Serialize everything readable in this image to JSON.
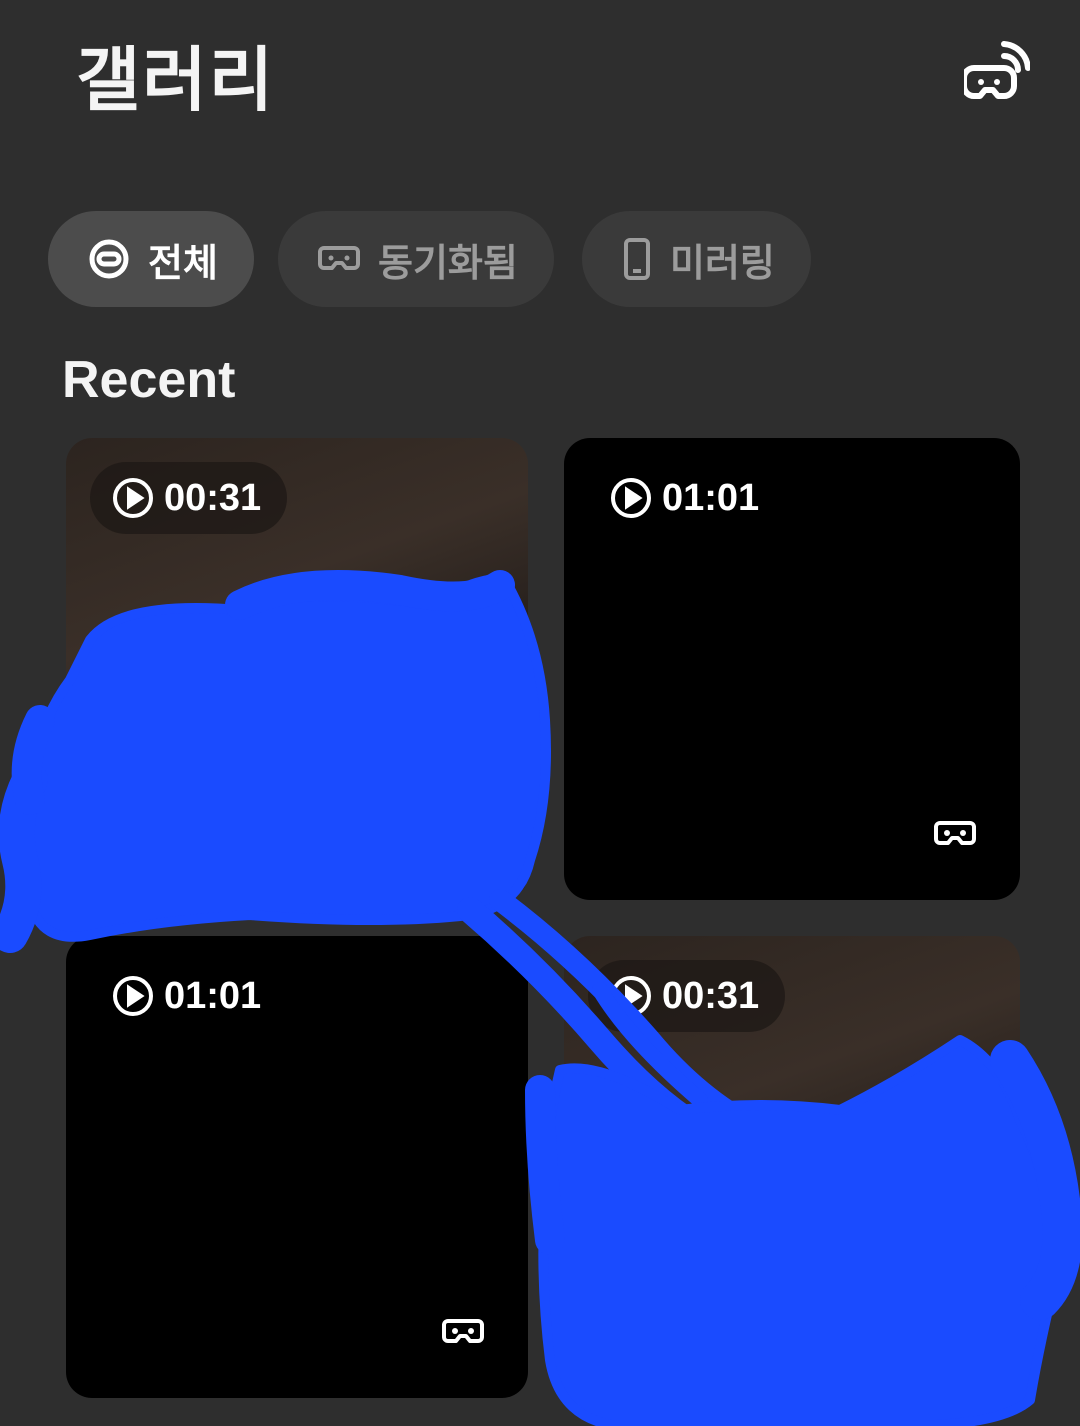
{
  "header": {
    "title": "갤러리",
    "cast_icon": "cast-vr-icon"
  },
  "filters": [
    {
      "label": "전체",
      "icon": "all-circle-icon",
      "active": true
    },
    {
      "label": "동기화됨",
      "icon": "vr-headset-icon",
      "active": false
    },
    {
      "label": "미러링",
      "icon": "phone-icon",
      "active": false
    }
  ],
  "section_title": "Recent",
  "videos": [
    {
      "duration": "00:31",
      "icon": "play-icon"
    },
    {
      "duration": "01:01",
      "icon": "play-icon",
      "badge_icon": "vr-headset-icon"
    },
    {
      "duration": "01:01",
      "icon": "play-icon",
      "badge_icon": "vr-headset-icon"
    },
    {
      "duration": "00:31",
      "icon": "play-icon"
    }
  ],
  "colors": {
    "background": "#2e2e2e",
    "chip_active": "#4c4c4c",
    "chip_inactive": "#3a3a3a",
    "scribble": "#1a4bff"
  }
}
